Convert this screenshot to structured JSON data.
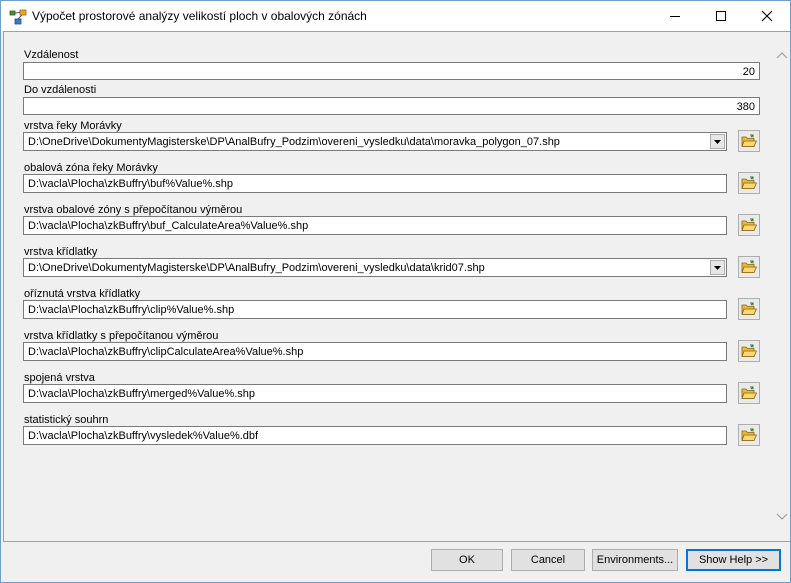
{
  "window": {
    "title": "Výpočet prostorové analýzy velikostí ploch v obalových zónách"
  },
  "fields": {
    "vzdalenost": {
      "label": "Vzdálenost",
      "value": "20"
    },
    "do_vzdalenosti": {
      "label": "Do vzdálenosti",
      "value": "380"
    },
    "vrstva_reky": {
      "label": "vrstva řeky Morávky",
      "value": "D:\\OneDrive\\DokumentyMagisterske\\DP\\AnalBufry_Podzim\\overeni_vysledku\\data\\moravka_polygon_07.shp"
    },
    "obalova_zona": {
      "label": "obalová zóna řeky Morávky",
      "value": "D:\\vacla\\Plocha\\zkBuffry\\buf%Value%.shp"
    },
    "vrstva_obalove_zony": {
      "label": "vrstva obalové zóny s přepočítanou výměrou",
      "value": "D:\\vacla\\Plocha\\zkBuffry\\buf_CalculateArea%Value%.shp"
    },
    "vrstva_kridlatky": {
      "label": "vrstva křídlatky",
      "value": "D:\\OneDrive\\DokumentyMagisterske\\DP\\AnalBufry_Podzim\\overeni_vysledku\\data\\krid07.shp"
    },
    "oriznuta_vrstva": {
      "label": "oříznutá vrstva křídlatky",
      "value": "D:\\vacla\\Plocha\\zkBuffry\\clip%Value%.shp"
    },
    "vrstva_kridlatky_prepoc": {
      "label": "vrstva křídlatky s přepočítanou výměrou",
      "value": "D:\\vacla\\Plocha\\zkBuffry\\clipCalculateArea%Value%.shp"
    },
    "spojena_vrstva": {
      "label": "spojená vrstva",
      "value": "D:\\vacla\\Plocha\\zkBuffry\\merged%Value%.shp"
    },
    "statisticky_souhrn": {
      "label": "statistický souhrn",
      "value": "D:\\vacla\\Plocha\\zkBuffry\\vysledek%Value%.dbf"
    }
  },
  "buttons": {
    "ok": "OK",
    "cancel": "Cancel",
    "environments": "Environments...",
    "show_help": "Show Help >>"
  },
  "icons": {
    "app": "toolbox-model-icon",
    "browse": "folder-open-icon"
  },
  "colors": {
    "accent": "#0078d7",
    "folder": "#e8b93a"
  }
}
